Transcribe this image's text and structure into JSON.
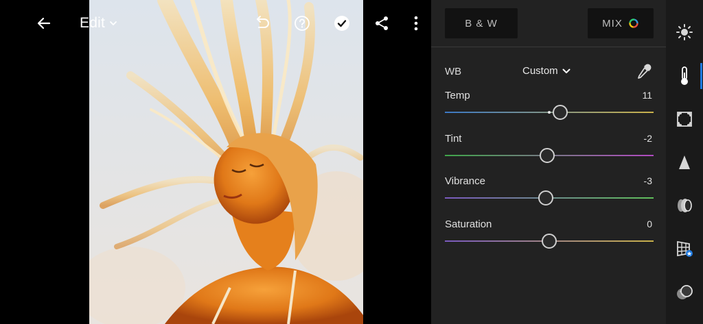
{
  "topbar": {
    "edit_label": "Edit",
    "icons": [
      "back-arrow-icon",
      "chevron-down-icon",
      "undo-icon",
      "help-icon",
      "done-check-icon",
      "share-icon",
      "more-vertical-icon"
    ]
  },
  "panel": {
    "bw_label": "B & W",
    "mix_label": "MIX",
    "wb": {
      "label": "WB",
      "value": "Custom"
    },
    "sliders": [
      {
        "name": "Temp",
        "value": "11",
        "position": 0.553,
        "gradient": [
          "#3b78c4",
          "#c9b14a"
        ]
      },
      {
        "name": "Tint",
        "value": "-2",
        "position": 0.49,
        "gradient": [
          "#3fa64a",
          "#b24ac2"
        ]
      },
      {
        "name": "Vibrance",
        "value": "-3",
        "position": 0.485,
        "gradient": [
          "#7a5abf",
          "#5fbf5a"
        ]
      },
      {
        "name": "Saturation",
        "value": "0",
        "position": 0.5,
        "gradient": [
          "#7a5abf",
          "#c9b14a"
        ]
      }
    ]
  },
  "rail": {
    "tools": [
      "light-icon",
      "color-temperature-icon",
      "effects-icon",
      "detail-icon",
      "optics-icon",
      "geometry-icon",
      "presets-icon"
    ],
    "active": "color-temperature-icon",
    "accent": "#1f7ae0"
  }
}
